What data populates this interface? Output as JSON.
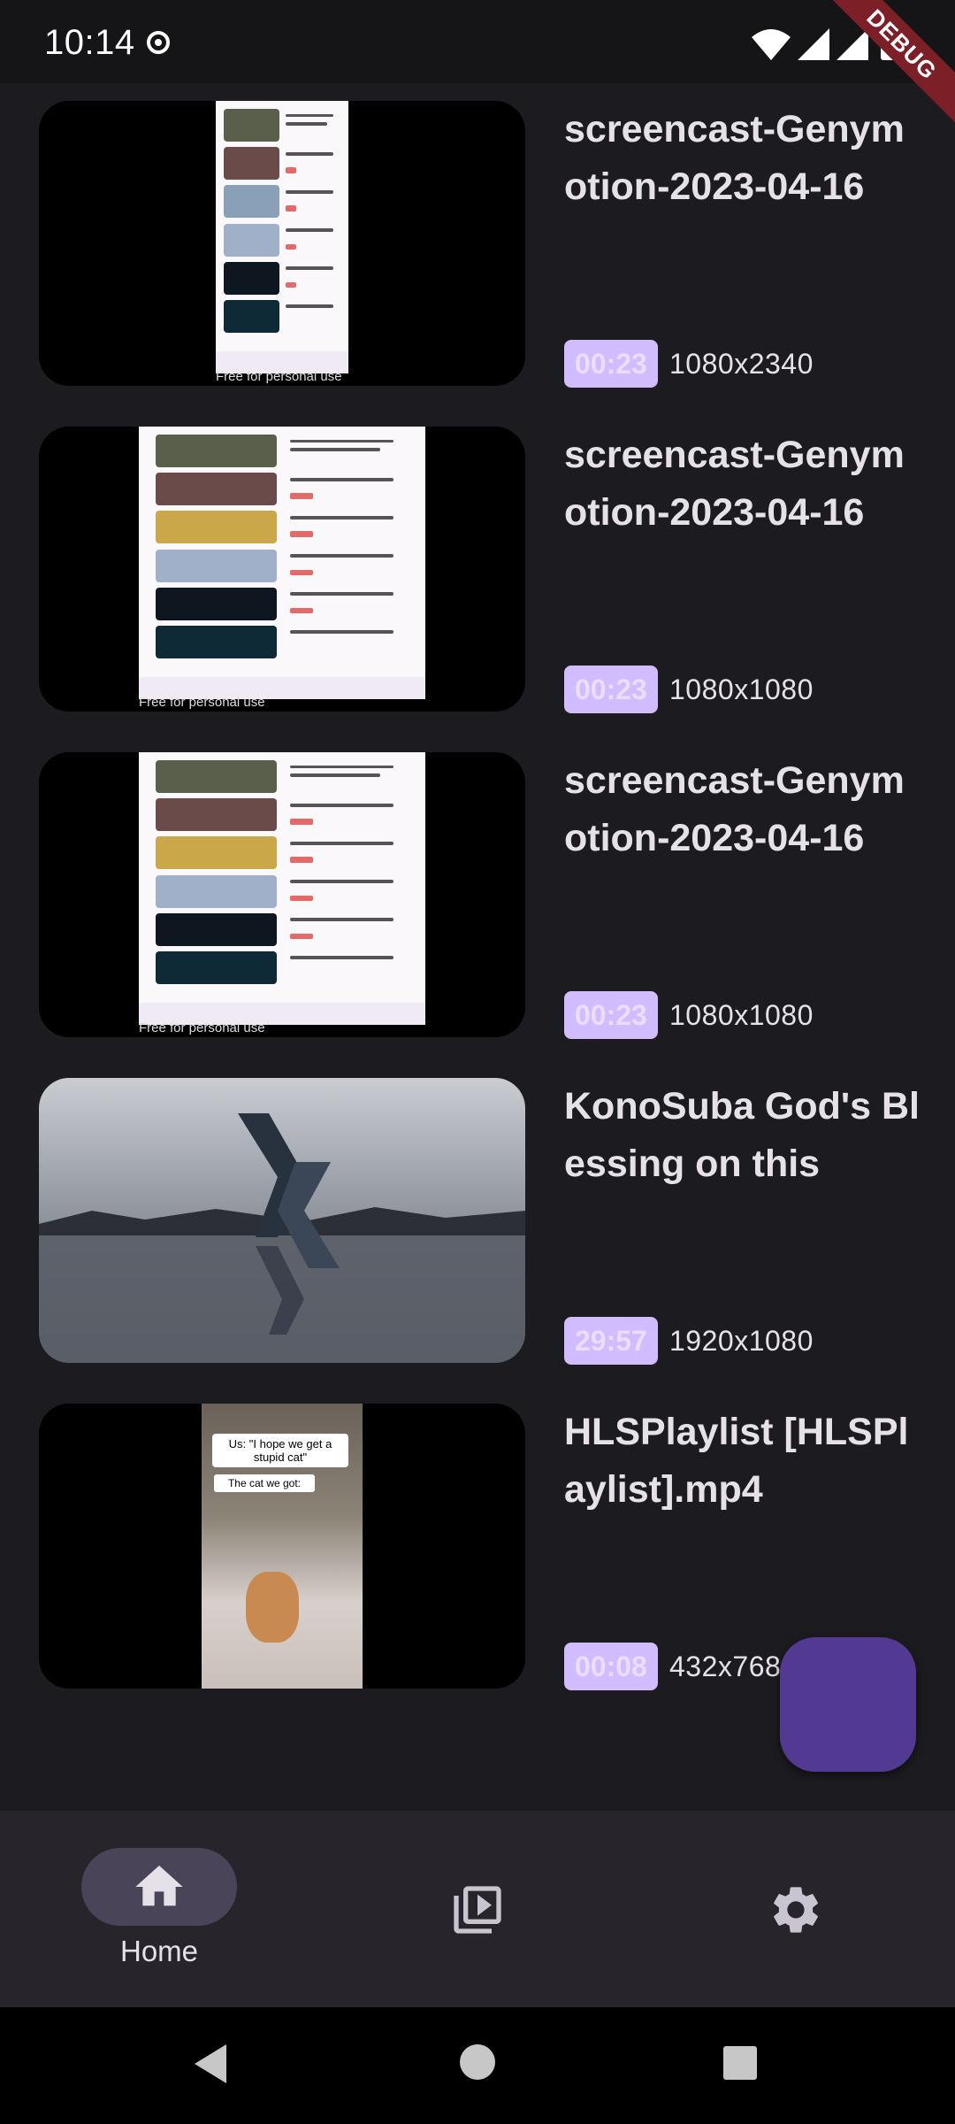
{
  "status_bar": {
    "time": "10:14",
    "debug_label": "DEBUG"
  },
  "videos": [
    {
      "title": "screencast-Genymotion-2023-04-16",
      "duration": "00:23",
      "resolution": "1080x2340",
      "thumb_caption": "Free for personal use"
    },
    {
      "title": "screencast-Genymotion-2023-04-16",
      "duration": "00:23",
      "resolution": "1080x1080",
      "thumb_caption": "Free for personal use"
    },
    {
      "title": "screencast-Genymotion-2023-04-16",
      "duration": "00:23",
      "resolution": "1080x1080",
      "thumb_caption": "Free for personal use"
    },
    {
      "title": "KonoSuba God's Blessing on this",
      "duration": "29:57",
      "resolution": "1920x1080"
    },
    {
      "title": "HLSPlaylist [HLSPlaylist].mp4",
      "duration": "00:08",
      "resolution": "432x768",
      "thumb_text_1": "Us: \"I hope we get a stupid cat\"",
      "thumb_text_2": "The cat we got:"
    }
  ],
  "bottom_nav": {
    "items": [
      {
        "label": "Home",
        "icon": "home-icon",
        "selected": true
      },
      {
        "label": "",
        "icon": "video-library-icon",
        "selected": false
      },
      {
        "label": "",
        "icon": "gear-icon",
        "selected": false
      }
    ]
  },
  "system_nav": {
    "icons": [
      "back-icon",
      "home-circle-icon",
      "recents-icon"
    ]
  },
  "colors": {
    "background": "#1c1b20",
    "duration_badge": "#d0bcff",
    "fab": "#523a93",
    "nav_pill": "#4a4458"
  }
}
